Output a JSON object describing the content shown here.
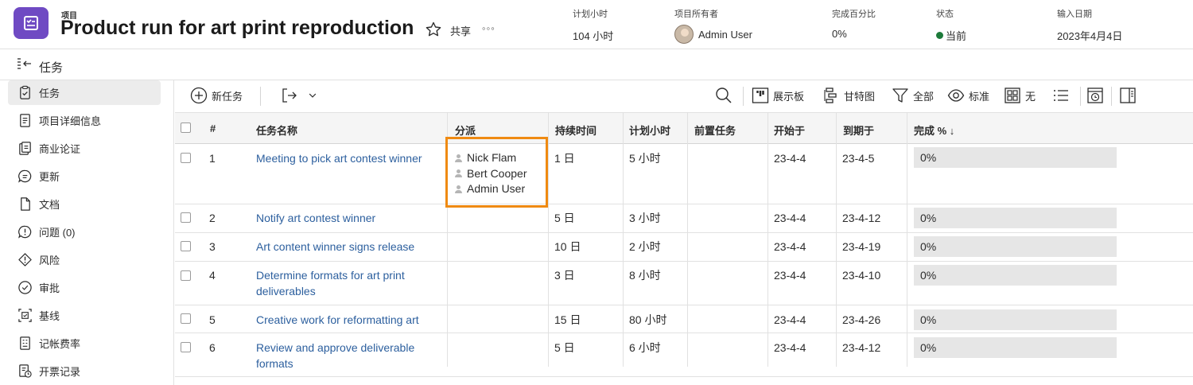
{
  "header": {
    "type_label": "项目",
    "title": "Product run for art print reproduction",
    "share_label": "共享",
    "more_label": "◦◦◦",
    "fields": {
      "planned_hours": {
        "label": "计划小时",
        "value": "104 小时"
      },
      "owner": {
        "label": "项目所有者",
        "value": "Admin User"
      },
      "percent_complete": {
        "label": "完成百分比",
        "value": "0%"
      },
      "status": {
        "label": "状态",
        "value": "当前",
        "color": "#1d7a3a"
      },
      "entry_date": {
        "label": "输入日期",
        "value": "2023年4月4日"
      }
    }
  },
  "subheader": {
    "title": "任务"
  },
  "sidebar": {
    "items": [
      {
        "label": "任务",
        "icon": "task-clipboard-icon",
        "active": true
      },
      {
        "label": "项目详细信息",
        "icon": "document-lines-icon"
      },
      {
        "label": "商业论证",
        "icon": "business-case-icon"
      },
      {
        "label": "更新",
        "icon": "chat-bubble-icon"
      },
      {
        "label": "文档",
        "icon": "file-icon"
      },
      {
        "label": "问题 (0)",
        "icon": "issue-bubble-icon"
      },
      {
        "label": "风险",
        "icon": "risk-diamond-icon"
      },
      {
        "label": "审批",
        "icon": "approval-check-icon"
      },
      {
        "label": "基线",
        "icon": "baseline-icon"
      },
      {
        "label": "记帐费率",
        "icon": "billing-rates-icon"
      },
      {
        "label": "开票记录",
        "icon": "billing-records-icon"
      }
    ]
  },
  "toolbar": {
    "new_task": "新任务",
    "board": "展示板",
    "gantt": "甘特图",
    "filter": "全部",
    "view": "标准",
    "grouping": "无"
  },
  "table": {
    "columns": {
      "num": "#",
      "name": "任务名称",
      "assign": "分派",
      "duration": "持续时间",
      "planned": "计划小时",
      "predecessors": "前置任务",
      "start": "开始于",
      "due": "到期于",
      "complete": "完成 % ↓"
    },
    "rows": [
      {
        "num": "1",
        "name": "Meeting to pick art contest winner",
        "assignees": [
          "Nick Flam",
          "Bert Cooper",
          "Admin User"
        ],
        "duration": "1 日",
        "planned": "5 小时",
        "predecessors": "",
        "start": "23-4-4",
        "due": "23-4-5",
        "complete": "0%"
      },
      {
        "num": "2",
        "name": "Notify art contest winner",
        "assignees": [],
        "duration": "5 日",
        "planned": "3 小时",
        "predecessors": "",
        "start": "23-4-4",
        "due": "23-4-12",
        "complete": "0%"
      },
      {
        "num": "3",
        "name": "Art content winner signs release",
        "assignees": [],
        "duration": "10 日",
        "planned": "2 小时",
        "predecessors": "",
        "start": "23-4-4",
        "due": "23-4-19",
        "complete": "0%"
      },
      {
        "num": "4",
        "name": "Determine formats for art print deliverables",
        "assignees": [],
        "duration": "3 日",
        "planned": "8 小时",
        "predecessors": "",
        "start": "23-4-4",
        "due": "23-4-10",
        "complete": "0%"
      },
      {
        "num": "5",
        "name": "Creative work for reformatting art",
        "assignees": [],
        "duration": "15 日",
        "planned": "80 小时",
        "predecessors": "",
        "start": "23-4-4",
        "due": "23-4-26",
        "complete": "0%"
      },
      {
        "num": "6",
        "name": "Review and approve deliverable formats",
        "assignees": [],
        "duration": "5 日",
        "planned": "6 小时",
        "predecessors": "",
        "start": "23-4-4",
        "due": "23-4-12",
        "complete": "0%"
      }
    ]
  }
}
